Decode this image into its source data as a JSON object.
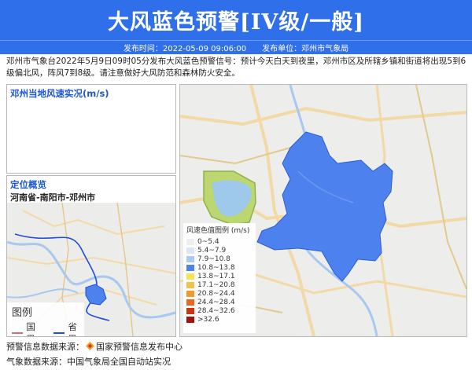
{
  "header": {
    "title": "大风蓝色预警[IV级/一般]",
    "publish_time": "发布时间：2022-05-09 09:06:00",
    "publisher": "发布单位：邓州市气象局"
  },
  "description": "邓州市气象台2022年5月9日09时05分发布大风蓝色预警信号：预计今天白天到夜里，邓州市区及所辖乡镇和街道将出现5到6级偏北风，阵风7到8级。请注意做好大风防范和森林防火安全。",
  "wind_panel": {
    "title": "邓州当地风速实况(m/s)"
  },
  "locator": {
    "title": "定位概览",
    "path": "河南省-南阳市-邓州市",
    "legend_title": "图例",
    "legend_items": [
      {
        "label": "国界",
        "color": "#d86a7c"
      },
      {
        "label": "省界",
        "color": "#1f4fd6"
      }
    ]
  },
  "wind_legend": {
    "title": "风速色值图例 (m/s)",
    "items": [
      {
        "label": "0~5.4",
        "color": "#eeeeee"
      },
      {
        "label": "5.4~7.9",
        "color": "#dbe7f7"
      },
      {
        "label": "7.9~10.8",
        "color": "#a9c9f2"
      },
      {
        "label": "10.8~13.8",
        "color": "#4d82ee"
      },
      {
        "label": "13.8~17.1",
        "color": "#f5e45a"
      },
      {
        "label": "17.1~20.8",
        "color": "#f3c04a"
      },
      {
        "label": "20.8~24.4",
        "color": "#f09a2c"
      },
      {
        "label": "24.4~28.4",
        "color": "#e86a1e"
      },
      {
        "label": "28.4~32.6",
        "color": "#cc3512"
      },
      {
        "label": ">32.6",
        "color": "#a4120c"
      }
    ]
  },
  "footer": {
    "source1_label": "预警信息数据来源：",
    "source1_value": "国家预警信息发布中心",
    "source2": "气象数据来源：中国气象局全国自动站实况"
  },
  "colors": {
    "header_bg": "#2f6fea",
    "warning_fill": "#4d82ee"
  }
}
